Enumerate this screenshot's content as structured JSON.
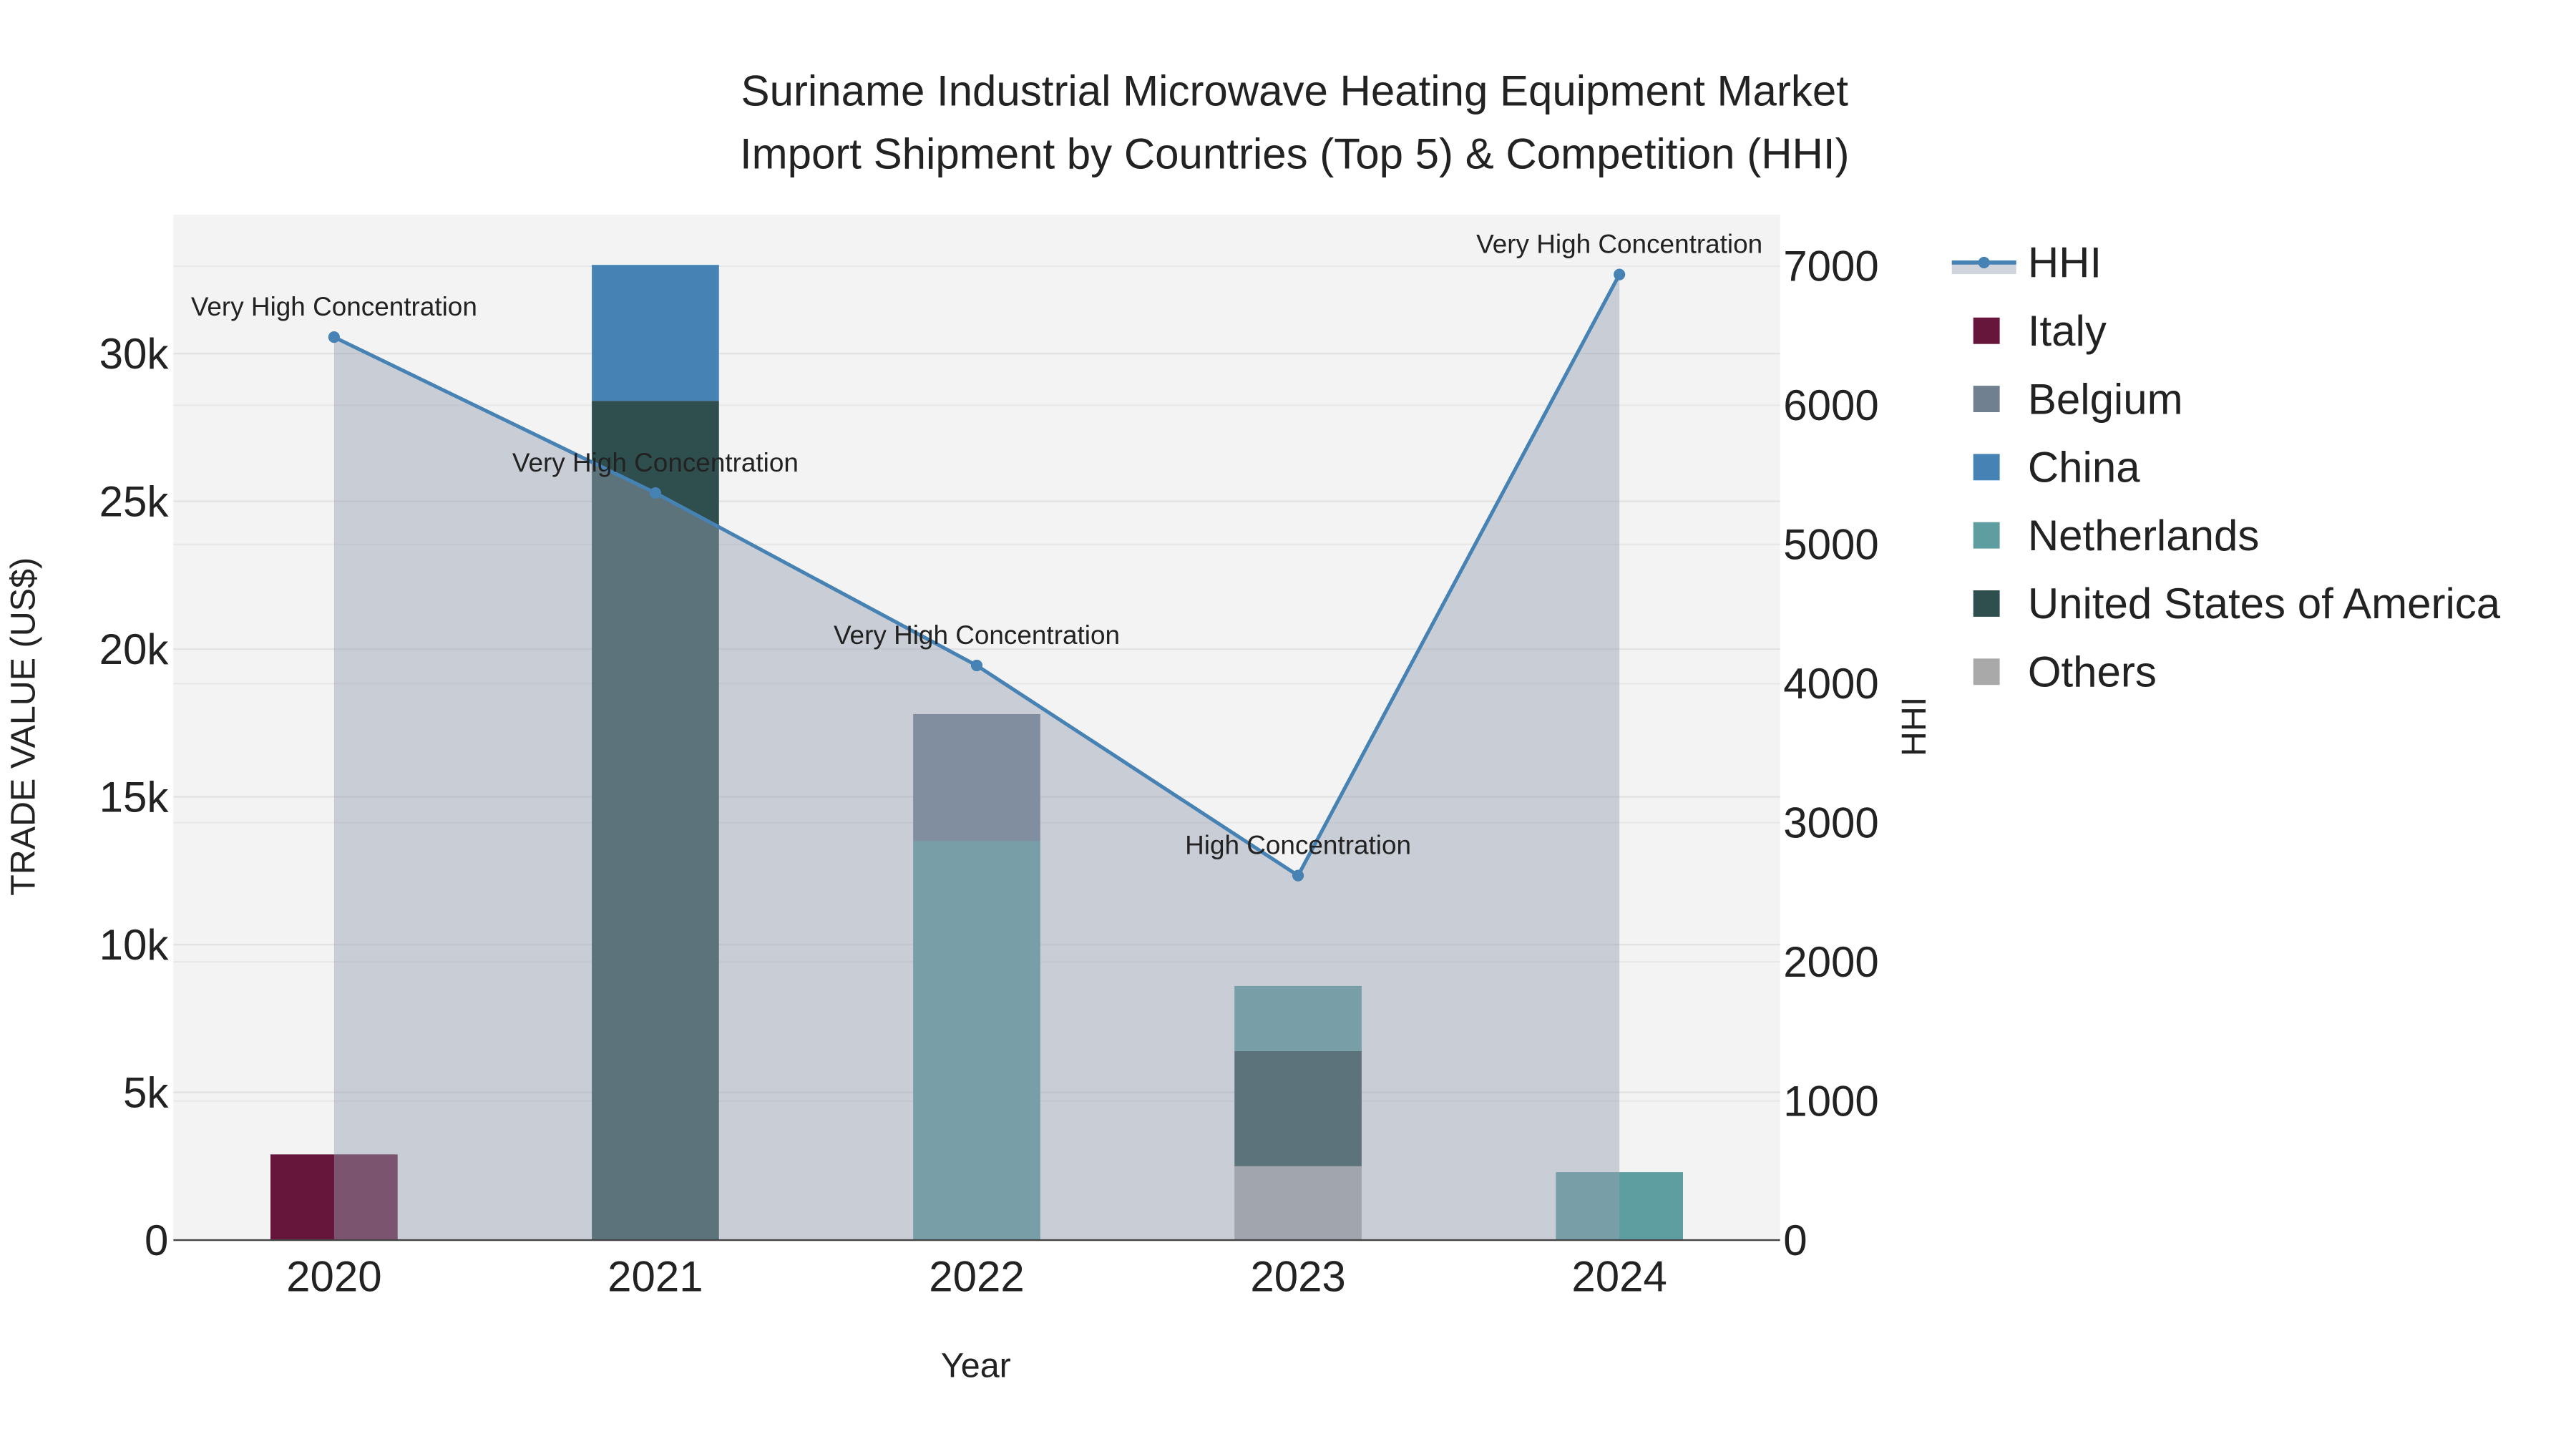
{
  "chart_data": {
    "type": "bar",
    "stacked": true,
    "title": [
      "Suriname Industrial Microwave Heating Equipment Market",
      "Import Shipment by Countries (Top 5) & Competition (HHI)"
    ],
    "xlabel": "Year",
    "ylabel": "TRADE VALUE (US$)",
    "y2label": "HHI",
    "categories": [
      "2020",
      "2021",
      "2022",
      "2023",
      "2024"
    ],
    "ylim": [
      0,
      34700
    ],
    "y2lim": [
      0,
      7370
    ],
    "yticks": [
      {
        "v": 0,
        "label": "0"
      },
      {
        "v": 5000,
        "label": "5k"
      },
      {
        "v": 10000,
        "label": "10k"
      },
      {
        "v": 15000,
        "label": "15k"
      },
      {
        "v": 20000,
        "label": "20k"
      },
      {
        "v": 25000,
        "label": "25k"
      },
      {
        "v": 30000,
        "label": "30k"
      }
    ],
    "y2ticks": [
      {
        "v": 0,
        "label": "0"
      },
      {
        "v": 1000,
        "label": "1000"
      },
      {
        "v": 2000,
        "label": "2000"
      },
      {
        "v": 3000,
        "label": "3000"
      },
      {
        "v": 4000,
        "label": "4000"
      },
      {
        "v": 5000,
        "label": "5000"
      },
      {
        "v": 6000,
        "label": "6000"
      },
      {
        "v": 7000,
        "label": "7000"
      }
    ],
    "series": [
      {
        "name": "Others",
        "color": "#a9a9a9",
        "values": [
          0,
          0,
          0,
          2500,
          0
        ]
      },
      {
        "name": "Italy",
        "color": "#65163a",
        "values": [
          2900,
          0,
          0,
          0,
          0
        ]
      },
      {
        "name": "United States of America",
        "color": "#2f4f4f",
        "values": [
          0,
          28400,
          0,
          3900,
          0
        ]
      },
      {
        "name": "Netherlands",
        "color": "#5f9ea0",
        "values": [
          0,
          0,
          13500,
          2200,
          2300
        ]
      },
      {
        "name": "Belgium",
        "color": "#708090",
        "values": [
          0,
          0,
          4300,
          0,
          0
        ]
      },
      {
        "name": "China",
        "color": "#4682b4",
        "values": [
          0,
          4600,
          0,
          0,
          0
        ]
      }
    ],
    "hhi": {
      "name": "HHI",
      "color": "#4682b4",
      "values": [
        6490,
        5370,
        4130,
        2620,
        6940
      ],
      "annotations": [
        "Very High Concentration",
        "Very High Concentration",
        "Very High Concentration",
        "High Concentration",
        "Very High Concentration"
      ]
    },
    "legend": {
      "placement": "right",
      "order": [
        "HHI",
        "Italy",
        "Belgium",
        "China",
        "Netherlands",
        "United States of America",
        "Others"
      ]
    },
    "grid": true
  }
}
